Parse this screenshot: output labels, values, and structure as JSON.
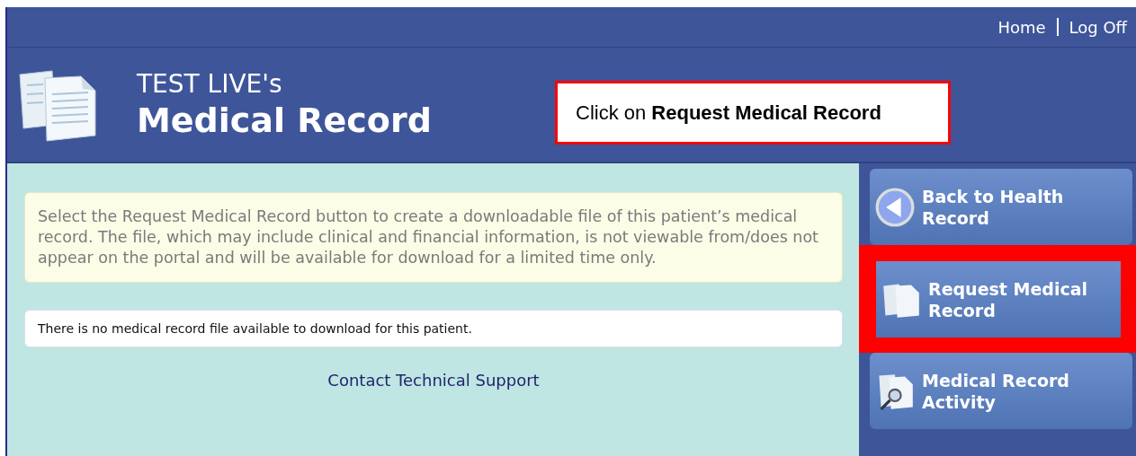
{
  "top_nav": [
    {
      "label": "Home"
    },
    {
      "label": "Log Off"
    }
  ],
  "header": {
    "subtitle": "TEST LIVE's",
    "title": "Medical Record"
  },
  "callout": {
    "text": "Click on **Request Medical Record**"
  },
  "info_message": "Select the Request Medical Record button to create a downloadable file of this patient’s medical record. The file, which may include clinical and financial information, is not viewable from/does not appear on the portal and will be available for download for a limited time only.",
  "status_message": "There is no medical record file available to download for this patient.",
  "support_link": "Contact Technical Support",
  "sidebar": {
    "items": [
      {
        "label": "Back to Health Record",
        "kind": "back",
        "highlighted": false
      },
      {
        "label": "Request Medical Record",
        "kind": "document",
        "highlighted": true
      },
      {
        "label": "Medical Record Activity",
        "kind": "search",
        "highlighted": false
      }
    ]
  }
}
